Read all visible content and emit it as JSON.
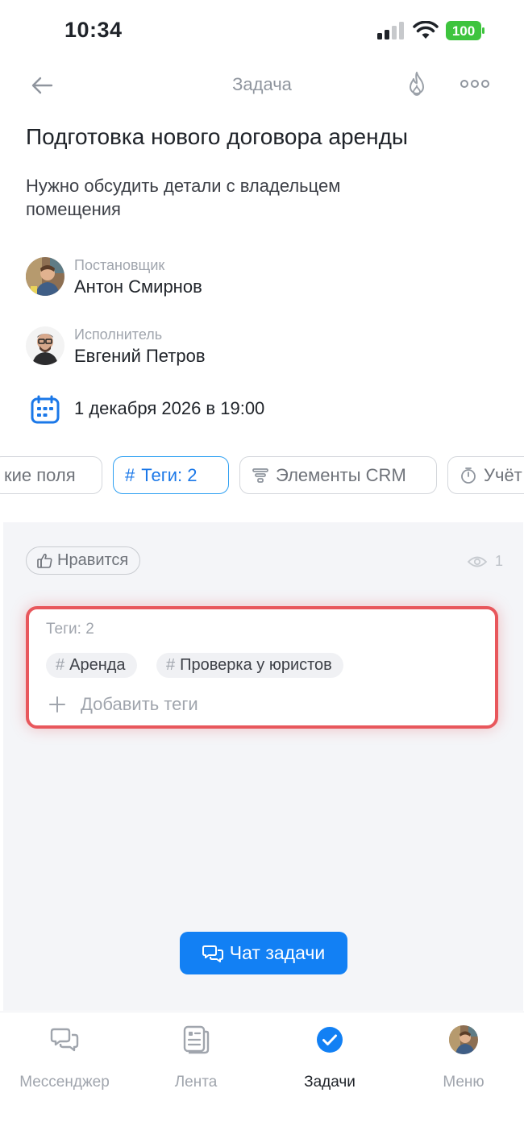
{
  "status_bar": {
    "time": "10:34",
    "battery": "100"
  },
  "nav": {
    "title": "Задача"
  },
  "task": {
    "title": "Подготовка нового договора аренды",
    "description": "Нужно обсудить детали с владельцем помещения"
  },
  "creator": {
    "role": "Постановщик",
    "name": "Антон Смирнов"
  },
  "assignee": {
    "role": "Исполнитель",
    "name": "Евгений Петров"
  },
  "deadline": {
    "text": "1 декабря 2026 в 19:00"
  },
  "chips": [
    {
      "label": "кие поля"
    },
    {
      "label": "Теги: 2"
    },
    {
      "label": "Элементы CRM"
    },
    {
      "label": "Учёт"
    }
  ],
  "panel": {
    "like_label": "Нравится",
    "views_count": "1",
    "tags_title": "Теги: 2",
    "tags": [
      {
        "label": "Аренда"
      },
      {
        "label": "Проверка у юристов"
      }
    ],
    "add_tags_label": "Добавить теги",
    "chat_button": "Чат задачи"
  },
  "tabbar": {
    "items": [
      {
        "label": "Мессенджер"
      },
      {
        "label": "Лента"
      },
      {
        "label": "Задачи"
      },
      {
        "label": "Меню"
      }
    ]
  },
  "colors": {
    "accent": "#1280f4",
    "highlight": "#e8575c",
    "battery": "#3ec43e"
  }
}
